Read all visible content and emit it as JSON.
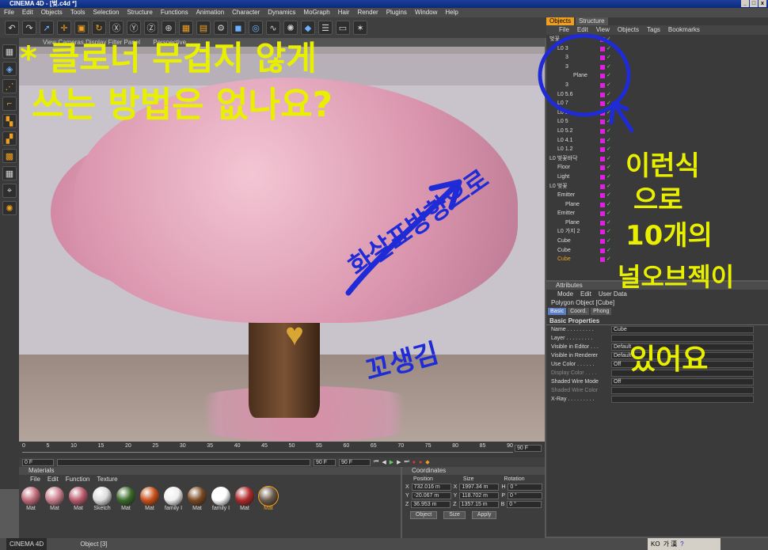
{
  "window": {
    "title": "CINEMA 4D - [벚.c4d *]",
    "btn_min": "_",
    "btn_max": "□",
    "btn_close": "x"
  },
  "menu": [
    "File",
    "Edit",
    "Objects",
    "Tools",
    "Selection",
    "Structure",
    "Functions",
    "Animation",
    "Character",
    "Dynamics",
    "MoGraph",
    "Hair",
    "Render",
    "Plugins",
    "Window",
    "Help"
  ],
  "viewport": {
    "header": "View  Cameras  Display  Filter  Panel",
    "label": "Perspective"
  },
  "timeline": {
    "ticks": [
      "0",
      "5",
      "10",
      "15",
      "20",
      "25",
      "30",
      "35",
      "40",
      "45",
      "50",
      "55",
      "60",
      "65",
      "70",
      "75",
      "80",
      "85",
      "90"
    ],
    "end_frame": "90 F",
    "start_field": "0 F",
    "cur_field": "0 F",
    "max_field": "90 F",
    "max_field2": "90 F"
  },
  "materials": {
    "title": "Materials",
    "menu": [
      "File",
      "Edit",
      "Function",
      "Texture"
    ],
    "items": [
      {
        "label": "Mat",
        "color": "#c06a7a"
      },
      {
        "label": "Mat",
        "color": "#c97e8c"
      },
      {
        "label": "Mat",
        "color": "#b85a6c"
      },
      {
        "label": "Sketch",
        "color": "#dcdcdc"
      },
      {
        "label": "Mat",
        "color": "#3a6a2a"
      },
      {
        "label": "Mat",
        "color": "#c8501a"
      },
      {
        "label": "family I",
        "color": "#eeeeee"
      },
      {
        "label": "Mat",
        "color": "#7a4a22"
      },
      {
        "label": "family I",
        "color": "#ffffff"
      },
      {
        "label": "Mat",
        "color": "#b02a2a"
      },
      {
        "label": "Mat",
        "color": "#6a5a4a"
      }
    ]
  },
  "coords": {
    "title": "Coordinates",
    "col_position": "Position",
    "col_size": "Size",
    "col_rotation": "Rotation",
    "rows": [
      {
        "axis": "X",
        "pos": "732.016 m",
        "saxis": "X",
        "size": "1997.34 m",
        "raxis": "H",
        "rot": "0 °"
      },
      {
        "axis": "Y",
        "pos": "-20.067 m",
        "saxis": "Y",
        "size": "118.702 m",
        "raxis": "P",
        "rot": "0 °"
      },
      {
        "axis": "Z",
        "pos": "36.953 m",
        "saxis": "Z",
        "size": "1357.15 m",
        "raxis": "B",
        "rot": "0 °"
      }
    ],
    "mode1": "Object",
    "mode2": "Size",
    "apply": "Apply"
  },
  "status": {
    "brand": "CINEMA 4D",
    "text": "Object [3]"
  },
  "objects": {
    "tab_objects": "Objects",
    "tab_structure": "Structure",
    "menu": [
      "File",
      "Edit",
      "View",
      "Objects",
      "Tags",
      "Bookmarks"
    ],
    "rows": [
      {
        "name": "벚꽃",
        "indent": 0
      },
      {
        "name": "L0 3",
        "indent": 1
      },
      {
        "name": "3",
        "indent": 2
      },
      {
        "name": "3",
        "indent": 2
      },
      {
        "name": "Plane",
        "indent": 3
      },
      {
        "name": "3",
        "indent": 2
      },
      {
        "name": "L0 5.6",
        "indent": 1
      },
      {
        "name": "L0 7",
        "indent": 1
      },
      {
        "name": "L0 3",
        "indent": 1
      },
      {
        "name": "L0 5",
        "indent": 1
      },
      {
        "name": "L0 5.2",
        "indent": 1
      },
      {
        "name": "L0 4.1",
        "indent": 1
      },
      {
        "name": "L0 1.2",
        "indent": 1
      },
      {
        "name": "L0 벚꽃바닥",
        "indent": 0
      },
      {
        "name": "Floor",
        "indent": 1
      },
      {
        "name": "Light",
        "indent": 1
      },
      {
        "name": "L0 벚꽃",
        "indent": 0
      },
      {
        "name": "Emitter",
        "indent": 1
      },
      {
        "name": "Plane",
        "indent": 2
      },
      {
        "name": "Emitter",
        "indent": 1
      },
      {
        "name": "Plane",
        "indent": 2
      },
      {
        "name": "L0 가지 2",
        "indent": 1
      },
      {
        "name": "Cube",
        "indent": 1
      },
      {
        "name": "Cube",
        "indent": 1
      },
      {
        "name": "Cube",
        "indent": 1,
        "hl": true
      }
    ]
  },
  "attributes": {
    "title": "Attributes",
    "menu": [
      "Mode",
      "Edit",
      "User Data"
    ],
    "object_type": "Polygon Object [Cube]",
    "tabs": [
      "Basic",
      "Coord.",
      "Phong"
    ],
    "section": "Basic Properties",
    "fields": [
      {
        "label": "Name . . . . . . . . .",
        "value": "Cube"
      },
      {
        "label": "Layer . . . . . . . . .",
        "value": ""
      },
      {
        "label": "Visible in Editor . . .",
        "value": "Default"
      },
      {
        "label": "Visible in Renderer",
        "value": "Default"
      },
      {
        "label": "Use Color . . . . . .",
        "value": "Off"
      },
      {
        "label": "Display Color . . . .",
        "value": "",
        "dim": true
      },
      {
        "label": "Shaded Wire Mode",
        "value": "Off"
      },
      {
        "label": "Shaded Wire Color",
        "value": "",
        "dim": true
      },
      {
        "label": "X-Ray . . . . . . . . .",
        "value": ""
      }
    ]
  },
  "ime": {
    "lang": "KO",
    "text": "가 漢"
  },
  "annotations": {
    "line1": "* 클로너 무겁지 않게",
    "line2": "쓰는 방법은 없나요?",
    "right1": "이런식",
    "right2": "으로",
    "right3": "10개의",
    "right4": "널오브젝이",
    "right5": "있어요",
    "middle1": "화살표방향으로",
    "middle2": "꼬생김",
    "yellow": "#e8f000",
    "blue": "#1f2bd6"
  }
}
